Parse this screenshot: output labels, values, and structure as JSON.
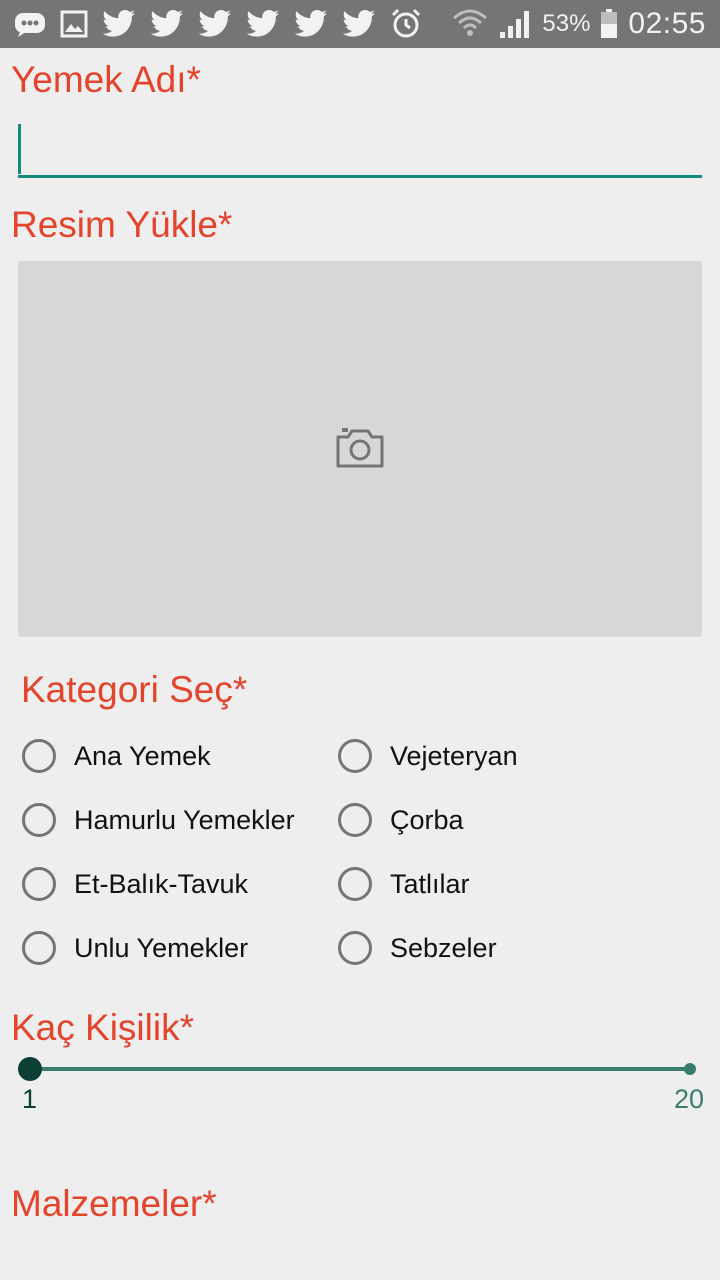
{
  "status_bar": {
    "battery_percent": "53%",
    "time": "02:55",
    "icons_left": [
      "chat-bubble-icon",
      "image-icon",
      "twitter-icon",
      "twitter-icon",
      "twitter-icon",
      "twitter-icon",
      "twitter-icon",
      "twitter-icon",
      "alarm-icon"
    ],
    "icons_right": [
      "wifi-icon",
      "signal-icon",
      "battery-icon"
    ]
  },
  "form": {
    "name_label": "Yemek Adı*",
    "name_value": "",
    "image_label": "Resim Yükle*",
    "category_label": "Kategori Seç*",
    "categories_left": [
      "Ana Yemek",
      "Hamurlu Yemekler",
      "Et-Balık-Tavuk",
      "Unlu Yemekler"
    ],
    "categories_right": [
      "Vejeteryan",
      "Çorba",
      "Tatlılar",
      "Sebzeler"
    ],
    "servings_label": "Kaç Kişilik*",
    "servings_min": "1",
    "servings_max": "20",
    "servings_value": 1,
    "ingredients_label": "Malzemeler*"
  },
  "colors": {
    "label": "#e4442c",
    "accent": "#128b7e",
    "status_bar": "#757575",
    "background": "#eeeeee"
  }
}
